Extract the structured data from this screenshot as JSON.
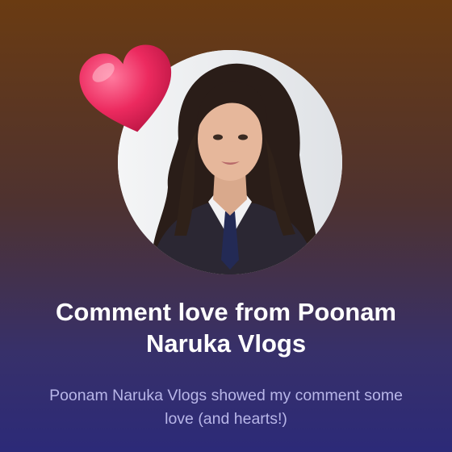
{
  "card": {
    "title": "Comment love from Poonam Naruka Vlogs",
    "description": "Poonam Naruka Vlogs showed my comment some love (and hearts!)"
  },
  "icons": {
    "heart": "heart-icon"
  },
  "colors": {
    "background_top": "#6a3b12",
    "background_bottom": "#2c2a78",
    "heart": "#e8245a",
    "title": "#ffffff",
    "description": "#b8b6e8"
  }
}
